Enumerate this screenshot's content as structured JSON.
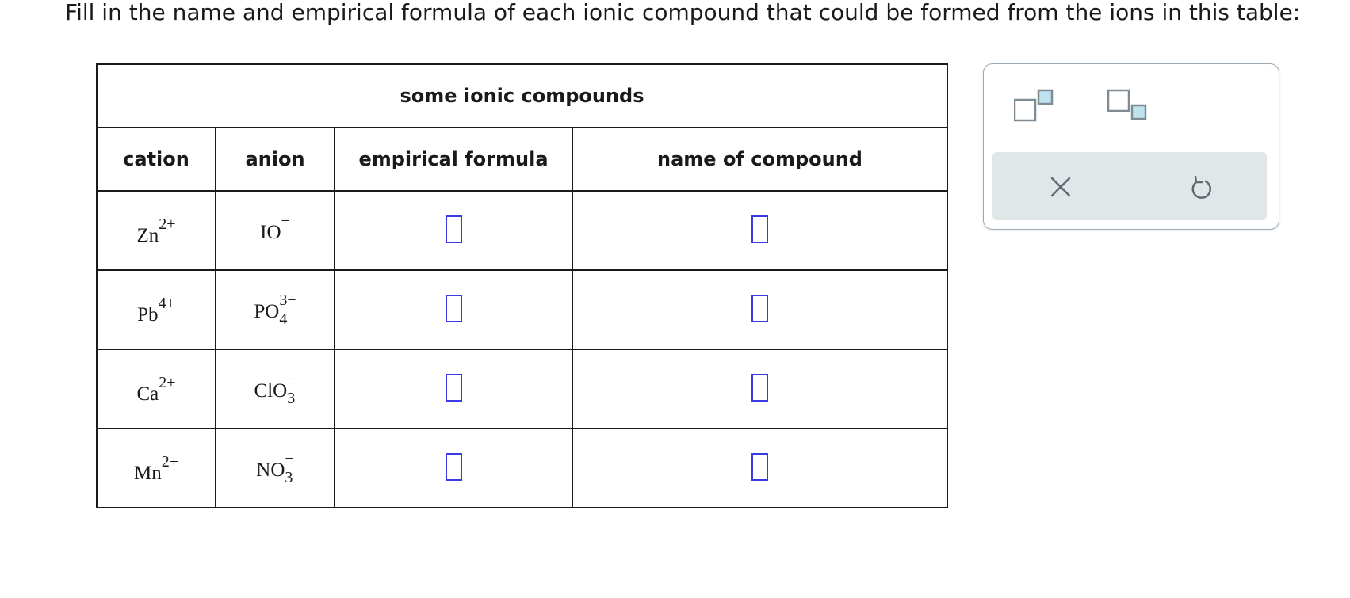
{
  "instructions": "Fill in the name and empirical formula of each ionic compound that could be formed from the ions in this table:",
  "table": {
    "caption": "some ionic compounds",
    "headers": {
      "cation": "cation",
      "anion": "anion",
      "formula": "empirical formula",
      "name": "name of compound"
    },
    "rows": [
      {
        "cation": {
          "symbol": "Zn",
          "charge": "2+"
        },
        "anion": {
          "symbol": "IO",
          "charge": "−",
          "subscript": ""
        },
        "formula_value": "",
        "name_value": ""
      },
      {
        "cation": {
          "symbol": "Pb",
          "charge": "4+"
        },
        "anion": {
          "symbol": "PO",
          "charge": "3−",
          "subscript": "4"
        },
        "formula_value": "",
        "name_value": ""
      },
      {
        "cation": {
          "symbol": "Ca",
          "charge": "2+"
        },
        "anion": {
          "symbol": "ClO",
          "charge": "−",
          "subscript": "3"
        },
        "formula_value": "",
        "name_value": ""
      },
      {
        "cation": {
          "symbol": "Mn",
          "charge": "2+"
        },
        "anion": {
          "symbol": "NO",
          "charge": "−",
          "subscript": "3"
        },
        "formula_value": "",
        "name_value": ""
      }
    ]
  },
  "toolbar": {
    "icons": [
      "superscript-icon",
      "subscript-icon",
      "clear-icon",
      "undo-icon"
    ],
    "colors": {
      "box_outline": "#7f8c94",
      "box_fill": "#bfe3ee",
      "icon": "#5e6b73",
      "strip": "#e1e6e9"
    }
  },
  "colors": {
    "answer_box": "#3a3ae6",
    "border": "#1a1a1a"
  }
}
